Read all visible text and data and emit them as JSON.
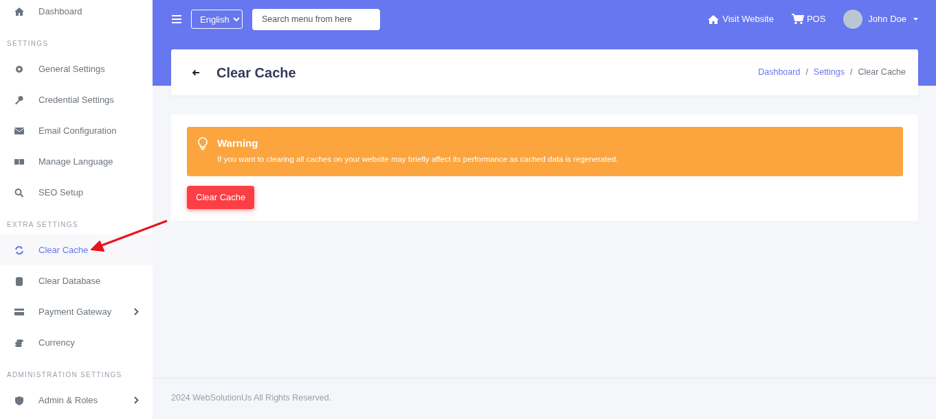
{
  "sidebar": {
    "items": [
      {
        "kind": "item",
        "label": "Dashboard",
        "selected": false,
        "expandable": false
      },
      {
        "kind": "section",
        "label": "SETTINGS"
      },
      {
        "kind": "item",
        "label": "General Settings",
        "selected": false,
        "expandable": false
      },
      {
        "kind": "item",
        "label": "Credential Settings",
        "selected": false,
        "expandable": false
      },
      {
        "kind": "item",
        "label": "Email Configuration",
        "selected": false,
        "expandable": false
      },
      {
        "kind": "item",
        "label": "Manage Language",
        "selected": false,
        "expandable": false
      },
      {
        "kind": "item",
        "label": "SEO Setup",
        "selected": false,
        "expandable": false
      },
      {
        "kind": "section",
        "label": "EXTRA SETTINGS"
      },
      {
        "kind": "item",
        "label": "Clear Cache",
        "selected": true,
        "expandable": false
      },
      {
        "kind": "item",
        "label": "Clear Database",
        "selected": false,
        "expandable": false
      },
      {
        "kind": "item",
        "label": "Payment Gateway",
        "selected": false,
        "expandable": true
      },
      {
        "kind": "item",
        "label": "Currency",
        "selected": false,
        "expandable": false
      },
      {
        "kind": "section",
        "label": "ADMINISTRATION SETTINGS"
      },
      {
        "kind": "item",
        "label": "Admin & Roles",
        "selected": false,
        "expandable": true
      }
    ]
  },
  "topbar": {
    "language": "English",
    "search": {
      "placeholder": "Search menu from here"
    },
    "links": [
      "Visit Website",
      "POS"
    ],
    "user": "John Doe"
  },
  "page_header": {
    "title": "Clear Cache",
    "separator": "/",
    "breadcrumb": [
      {
        "label": "Dashboard",
        "link": true
      },
      {
        "label": "Settings",
        "link": true
      },
      {
        "label": "Clear Cache",
        "link": false
      }
    ]
  },
  "alert": {
    "title": "Warning",
    "message": "If you want to clearing all caches on your website may briefly affect its performance as cached data is regenerated."
  },
  "action_button": "Clear Cache",
  "footer": "2024 WebSolutionUs All Rights Reserved.",
  "annotations": [
    {
      "kind": "arrow"
    }
  ]
}
